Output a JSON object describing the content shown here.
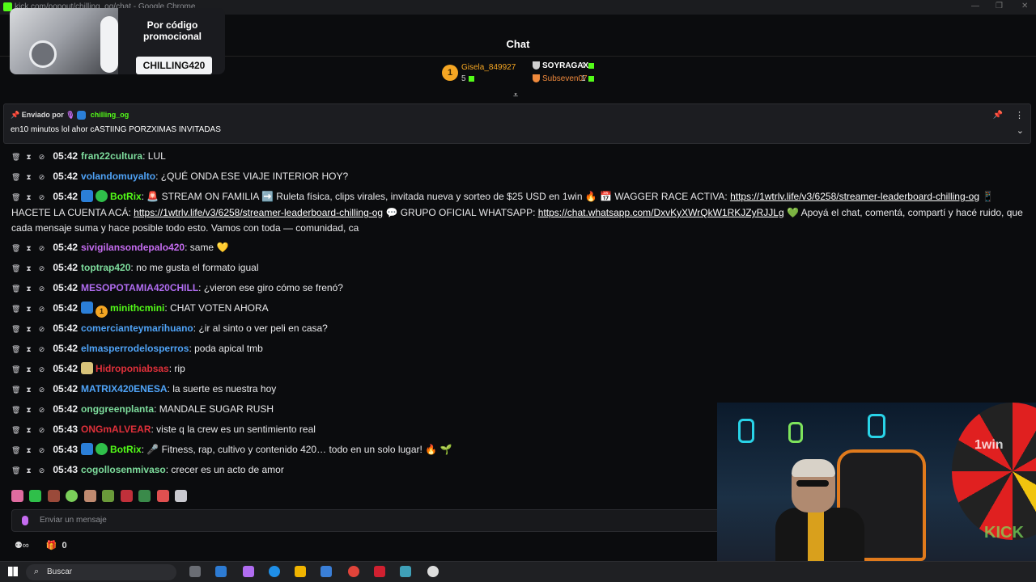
{
  "window": {
    "title": "kick.com/popout/chilling_og/chat - Google Chrome",
    "controls": [
      "—",
      "❐",
      "✕"
    ]
  },
  "promo": {
    "title": "Por código promocional",
    "code": "CHILLING420"
  },
  "chat": {
    "header": "Chat",
    "scroll_icon": "scroll-to-bottom-icon"
  },
  "leaderboard": {
    "rank": "1",
    "top": [
      {
        "name": "Gisela_849927",
        "count": "5"
      },
      {
        "name": "SOYRAGAX",
        "count": "1"
      },
      {
        "name": "Subseven07",
        "count": "1"
      }
    ]
  },
  "pinned": {
    "label": "Enviado por",
    "user": "chilling_og",
    "message": "en10 minutos lol ahor cASTIING PORZXIMAS INVITADAS"
  },
  "messages": [
    {
      "time": "05:42",
      "user": "fran22cultura",
      "color": "#7ddc9c",
      "text": "LUL"
    },
    {
      "time": "05:42",
      "user": "volandomuyalto",
      "color": "#4fa3f7",
      "text": "¿QUÉ ONDA ESE VIAJE INTERIOR HOY?"
    },
    {
      "time": "05:42",
      "user": "BotRix",
      "color": "#53fc18",
      "text": "🚨 STREAM ON FAMILIA ➡️ Ruleta física, clips virales, invitada nueva y sorteo de $25 USD en 1win 🔥 📅 WAGGER RACE ACTIVA:",
      "link1": "https://1wtrlv.life/v3/6258/streamer-leaderboard-chilling-og",
      "text2": "📱 HACETE LA CUENTA ACÁ:",
      "link2": "https://1wtrlv.life/v3/6258/streamer-leaderboard-chilling-og",
      "text3": "💬 GRUPO OFICIAL WHATSAPP:",
      "link3": "https://chat.whatsapp.com/DxvKyXWrQkW1RKJZyRJJLg",
      "text4": "💚 Apoyá el chat, comentá, compartí y hacé ruido, que cada mensaje suma y hace posible todo esto. Vamos con toda — comunidad, ca"
    },
    {
      "time": "05:42",
      "user": "sivigilansondepalo420",
      "color": "#c56cf0",
      "text": "same 💛"
    },
    {
      "time": "05:42",
      "user": "toptrap420",
      "color": "#7ddc9c",
      "text": "no me gusta el formato igual"
    },
    {
      "time": "05:42",
      "user": "MESOPOTAMIA420CHILL",
      "color": "#b06cf0",
      "text": "¿vieron ese giro cómo se frenó?"
    },
    {
      "time": "05:42",
      "user": "minithcmini",
      "color": "#53fc18",
      "text": "CHAT VOTEN AHORA",
      "gold_badge": "1"
    },
    {
      "time": "05:42",
      "user": "comercianteymarihuano",
      "color": "#4fa3f7",
      "text": "¿ir al sinto o ver peli en casa?"
    },
    {
      "time": "05:42",
      "user": "elmasperrodelosperros",
      "color": "#4fa3f7",
      "text": "poda apical tmb"
    },
    {
      "time": "05:42",
      "user": "Hidroponiabsas",
      "color": "#e0303a",
      "text": "rip"
    },
    {
      "time": "05:42",
      "user": "MATRIX420ENESA",
      "color": "#4fa3f7",
      "text": "la suerte es nuestra hoy"
    },
    {
      "time": "05:42",
      "user": "onggreenplanta",
      "color": "#7ddc9c",
      "text": "MANDALE SUGAR RUSH"
    },
    {
      "time": "05:43",
      "user": "ONGmALVEAR",
      "color": "#e0303a",
      "text": "viste q la crew es un sentimiento real"
    },
    {
      "time": "05:43",
      "user": "BotRix",
      "color": "#53fc18",
      "text": "🎤 Fitness, rap, cultivo y contenido 420… todo en un solo lugar! 🔥 🌱"
    },
    {
      "time": "05:43",
      "user": "cogollosenmivaso",
      "color": "#7ddc9c",
      "text": "crecer es un acto de amor"
    }
  ],
  "input": {
    "placeholder": "Enviar un mensaje"
  },
  "footer": {
    "infinity": "∞",
    "count": "0"
  },
  "webcam": {
    "win_text": "1win",
    "kick_text": "KICK"
  },
  "taskbar": {
    "search_label": "Buscar"
  }
}
